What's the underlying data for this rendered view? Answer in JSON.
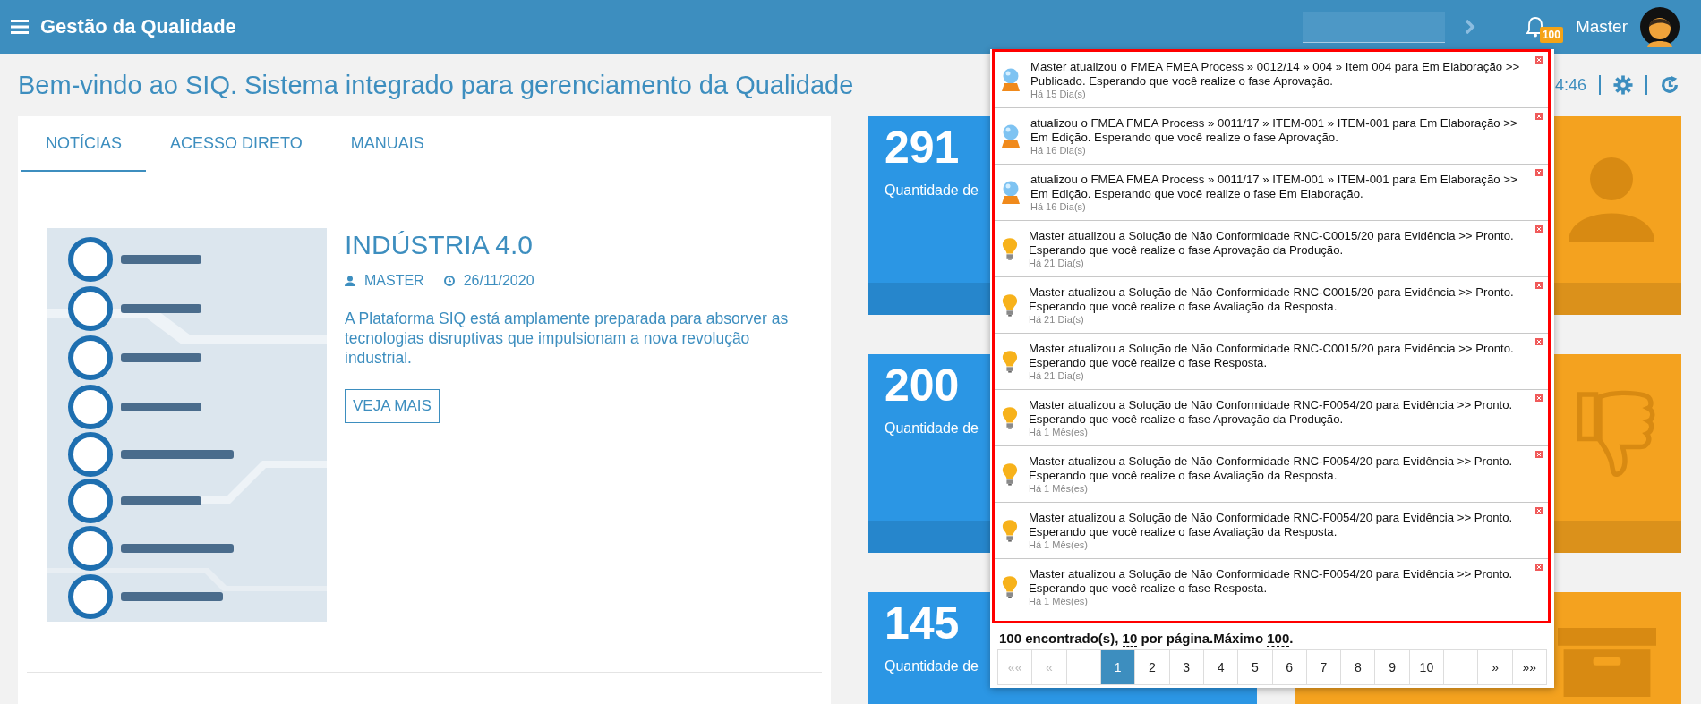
{
  "header": {
    "title": "Gestão da Qualidade",
    "notification_count": "100",
    "user": "Master"
  },
  "welcome": "Bem-vindo ao SIQ. Sistema integrado para gerenciamento da Qualidade",
  "clock": "4:46",
  "tabs": [
    {
      "label": "NOTÍCIAS",
      "selected": true
    },
    {
      "label": "ACESSO DIRETO",
      "selected": false
    },
    {
      "label": "MANUAIS",
      "selected": false
    }
  ],
  "article": {
    "title": "INDÚSTRIA 4.0",
    "author": "MASTER",
    "date": "26/11/2020",
    "text": "A Plataforma SIQ está amplamente preparada para absorver as tecnologias disruptivas que impulsionam a nova revolução industrial.",
    "button": "VEJA MAIS"
  },
  "tiles": [
    {
      "value": "291",
      "label": "Quantidade de"
    },
    {
      "value": "200",
      "label": "Quantidade de"
    },
    {
      "value": "145",
      "label": "Quantidade de"
    }
  ],
  "notifications": {
    "items": [
      {
        "kind": "orb",
        "text": "Master atualizou o FMEA FMEA Process » 0012/14 » 004 » Item 004 para Em Elaboração >> Publicado. Esperando que você realize o fase Aprovação.",
        "time": "Há 15 Dia(s)"
      },
      {
        "kind": "orb",
        "text": "atualizou o FMEA FMEA Process » 0011/17 » ITEM-001 » ITEM-001 para Em Elaboração >> Em Edição. Esperando que você realize o fase Aprovação.",
        "time": "Há 16 Dia(s)"
      },
      {
        "kind": "orb",
        "text": "atualizou o FMEA FMEA Process » 0011/17 » ITEM-001 » ITEM-001 para Em Elaboração >> Em Edição. Esperando que você realize o fase Em Elaboração.",
        "time": "Há 16 Dia(s)"
      },
      {
        "kind": "bulb",
        "text": "Master atualizou a Solução de Não Conformidade RNC-C0015/20 para Evidência >> Pronto. Esperando que você realize o fase Aprovação da Produção.",
        "time": "Há 21 Dia(s)"
      },
      {
        "kind": "bulb",
        "text": "Master atualizou a Solução de Não Conformidade RNC-C0015/20 para Evidência >> Pronto. Esperando que você realize o fase Avaliação da Resposta.",
        "time": "Há 21 Dia(s)"
      },
      {
        "kind": "bulb",
        "text": "Master atualizou a Solução de Não Conformidade RNC-C0015/20 para Evidência >> Pronto. Esperando que você realize o fase Resposta.",
        "time": "Há 21 Dia(s)"
      },
      {
        "kind": "bulb",
        "text": "Master atualizou a Solução de Não Conformidade RNC-F0054/20 para Evidência >> Pronto. Esperando que você realize o fase Aprovação da Produção.",
        "time": "Há 1 Mês(es)"
      },
      {
        "kind": "bulb",
        "text": "Master atualizou a Solução de Não Conformidade RNC-F0054/20 para Evidência >> Pronto. Esperando que você realize o fase Avaliação da Resposta.",
        "time": "Há 1 Mês(es)"
      },
      {
        "kind": "bulb",
        "text": "Master atualizou a Solução de Não Conformidade RNC-F0054/20 para Evidência >> Pronto. Esperando que você realize o fase Avaliação da Resposta.",
        "time": "Há 1 Mês(es)"
      },
      {
        "kind": "bulb",
        "text": "Master atualizou a Solução de Não Conformidade RNC-F0054/20 para Evidência >> Pronto. Esperando que você realize o fase Resposta.",
        "time": "Há 1 Mês(es)"
      }
    ],
    "summary": {
      "found": "100 encontrado(s),",
      "per_page": "10",
      "middle": "por página.Máximo",
      "max": "100",
      "end": "."
    },
    "pagination": {
      "first": [
        {
          "label": "««",
          "disabled": true
        },
        {
          "label": "«",
          "disabled": true
        }
      ],
      "pages": [
        {
          "label": "1",
          "selected": true
        },
        {
          "label": "2",
          "selected": false
        },
        {
          "label": "3",
          "selected": false
        },
        {
          "label": "4",
          "selected": false
        },
        {
          "label": "5",
          "selected": false
        },
        {
          "label": "6",
          "selected": false
        },
        {
          "label": "7",
          "selected": false
        },
        {
          "label": "8",
          "selected": false
        },
        {
          "label": "9",
          "selected": false
        },
        {
          "label": "10",
          "selected": false
        }
      ],
      "last": [
        {
          "label": "»",
          "disabled": false
        },
        {
          "label": "»»",
          "disabled": false
        }
      ]
    }
  }
}
